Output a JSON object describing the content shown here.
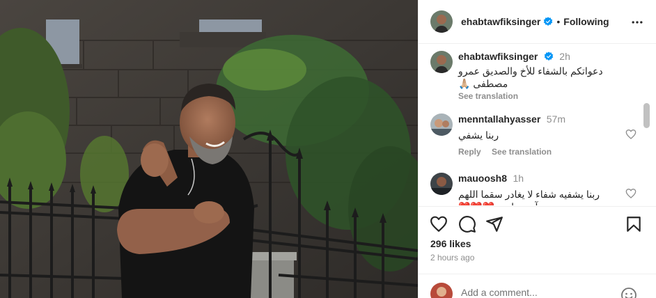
{
  "post": {
    "author": "ehabtawfiksinger",
    "follow_status": "Following",
    "separator": "•",
    "likes": "296 likes",
    "time_ago": "2 hours ago"
  },
  "caption": {
    "username": "ehabtawfiksinger",
    "time": "2h",
    "text": "دعواتكم بالشفاء للأخ والصديق عمرو مصطفى 🙏🏼",
    "see_translation": "See translation"
  },
  "comments": [
    {
      "username": "menntallahyasser",
      "time": "57m",
      "text": "ربنا يشفي",
      "reply": "Reply",
      "see_translation": "See translation"
    },
    {
      "username": "mauoosh8",
      "time": "1h",
      "text": "ربنا يشفيه شفاء لا يغادر سقما اللهم آمين يارب ❤️❤️❤️"
    }
  ],
  "add_comment": {
    "placeholder": "Add a comment..."
  },
  "icons": {
    "verified": "verified-badge-icon",
    "more": "more-options-icon",
    "like": "heart-icon",
    "comment": "comment-icon",
    "share": "share-icon",
    "save": "bookmark-icon",
    "emoji": "emoji-icon"
  },
  "colors": {
    "verified_blue": "#0095f6",
    "muted_text": "#8e8e8e",
    "text": "#262626",
    "heart_red": "#ed1c24"
  }
}
